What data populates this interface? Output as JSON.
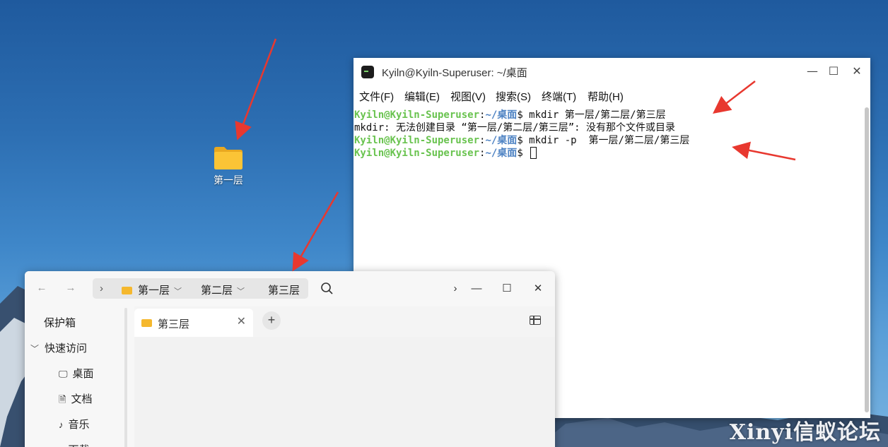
{
  "desktop": {
    "folder_label": "第一层",
    "watermark": "Xinyi信蚁论坛"
  },
  "terminal": {
    "title": "Kyiln@Kyiln-Superuser: ~/桌面",
    "menu": [
      "文件(F)",
      "编辑(E)",
      "视图(V)",
      "搜索(S)",
      "终端(T)",
      "帮助(H)"
    ],
    "prompt_user": "Kyiln@Kyiln-Superuser",
    "prompt_sep": ":",
    "prompt_path": "~/桌面",
    "prompt_char": "$",
    "lines": [
      {
        "type": "command",
        "text": " mkdir 第一层/第二层/第三层"
      },
      {
        "type": "output",
        "text": "mkdir: 无法创建目录 “第一层/第二层/第三层”: 没有那个文件或目录"
      },
      {
        "type": "command",
        "text": " mkdir -p  第一层/第二层/第三层"
      },
      {
        "type": "prompt",
        "text": " "
      }
    ]
  },
  "file_manager": {
    "breadcrumbs": [
      "第一层",
      "第二层",
      "第三层"
    ],
    "sidebar": {
      "vault": "保护箱",
      "quick_access": "快速访问",
      "items": [
        {
          "icon": "monitor-icon",
          "label": "桌面"
        },
        {
          "icon": "document-icon",
          "label": "文档"
        },
        {
          "icon": "music-icon",
          "label": "音乐"
        },
        {
          "icon": "download-icon",
          "label": "下载"
        }
      ]
    },
    "tab_label": "第三层"
  },
  "colors": {
    "prompt_user": "#69c34f",
    "prompt_path": "#4d82c3",
    "folder": "#f5b82e",
    "arrow": "#e8382f"
  }
}
